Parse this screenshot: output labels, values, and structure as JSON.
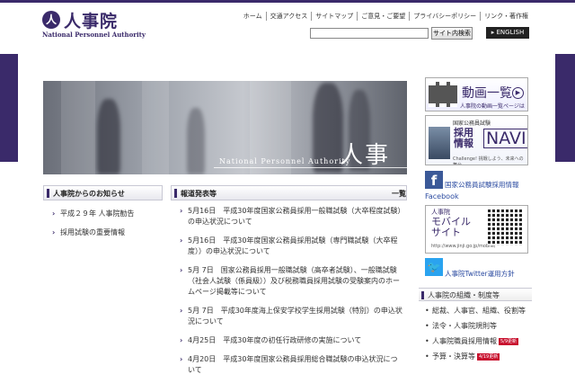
{
  "header": {
    "logo_title": "人事院",
    "logo_sub": "National Personnel Authority",
    "util_nav": [
      "ホーム",
      "交通アクセス",
      "サイトマップ",
      "ご意見・ご要望",
      "プライバシーポリシー",
      "リンク・著作権"
    ],
    "search_placeholder": "",
    "search_button": "サイト内検索",
    "english_button": "▸ ENGLISH"
  },
  "hero": {
    "en": "National Personnel Authority",
    "ja": "人事院"
  },
  "notice": {
    "title": "人事院からのお知らせ",
    "items": [
      "平成２９年 人事院勧告",
      "採用試験の重要情報"
    ]
  },
  "news": {
    "title": "報道発表等",
    "more": "一覧",
    "items": [
      "5月16日　平成30年度国家公務員採用一般職試験（大卒程度試験）の申込状況について",
      "5月16日　平成30年度国家公務員採用試験（専門職試験（大卒程度））の申込状況について",
      "5月 7日　国家公務員採用一般職試験（高卒者試験）、一般職試験（社会人試験（係員級））及び税務職員採用試験の受験案内のホームページ掲載等について",
      "5月 7日　平成30年度海上保安学校学生採用試験（特別）の申込状況について",
      "4月25日　平成30年度の初任行政研修の実施について",
      "4月20日　平成30年度国家公務員採用総合職試験の申込状況について"
    ]
  },
  "sidebar": {
    "video_title": "動画一覧",
    "video_sub": "人事院の動画一覧ページはこちら",
    "navi_label": "国家公務員試験",
    "navi_title": "採用\n情報",
    "navi_big": "NAVI",
    "navi_sub": "Challenge! 挑戦しよう、未来への舞台",
    "fb_text": "国家公務員試験採用情報",
    "fb_text2": "Facebook",
    "mobile_label": "人事院",
    "mobile_title": "モバイル\nサイト",
    "mobile_url": "http://www.jinji.go.jp/mobile/",
    "twitter_text": "人事院Twitter運用方針",
    "org_title": "人事院の組織・制度等",
    "org_items": [
      {
        "label": "総裁、人事官、組織、役割等",
        "badge": ""
      },
      {
        "label": "法令・人事院規則等",
        "badge": ""
      },
      {
        "label": "人事院職員採用情報",
        "badge": "5/9更新"
      },
      {
        "label": "予算・決算等",
        "badge": "4/19更新"
      }
    ]
  },
  "colors": {
    "brand": "#3a2a6a",
    "facebook": "#3b5998",
    "twitter": "#2aa3ef",
    "badge": "#c8102e"
  }
}
